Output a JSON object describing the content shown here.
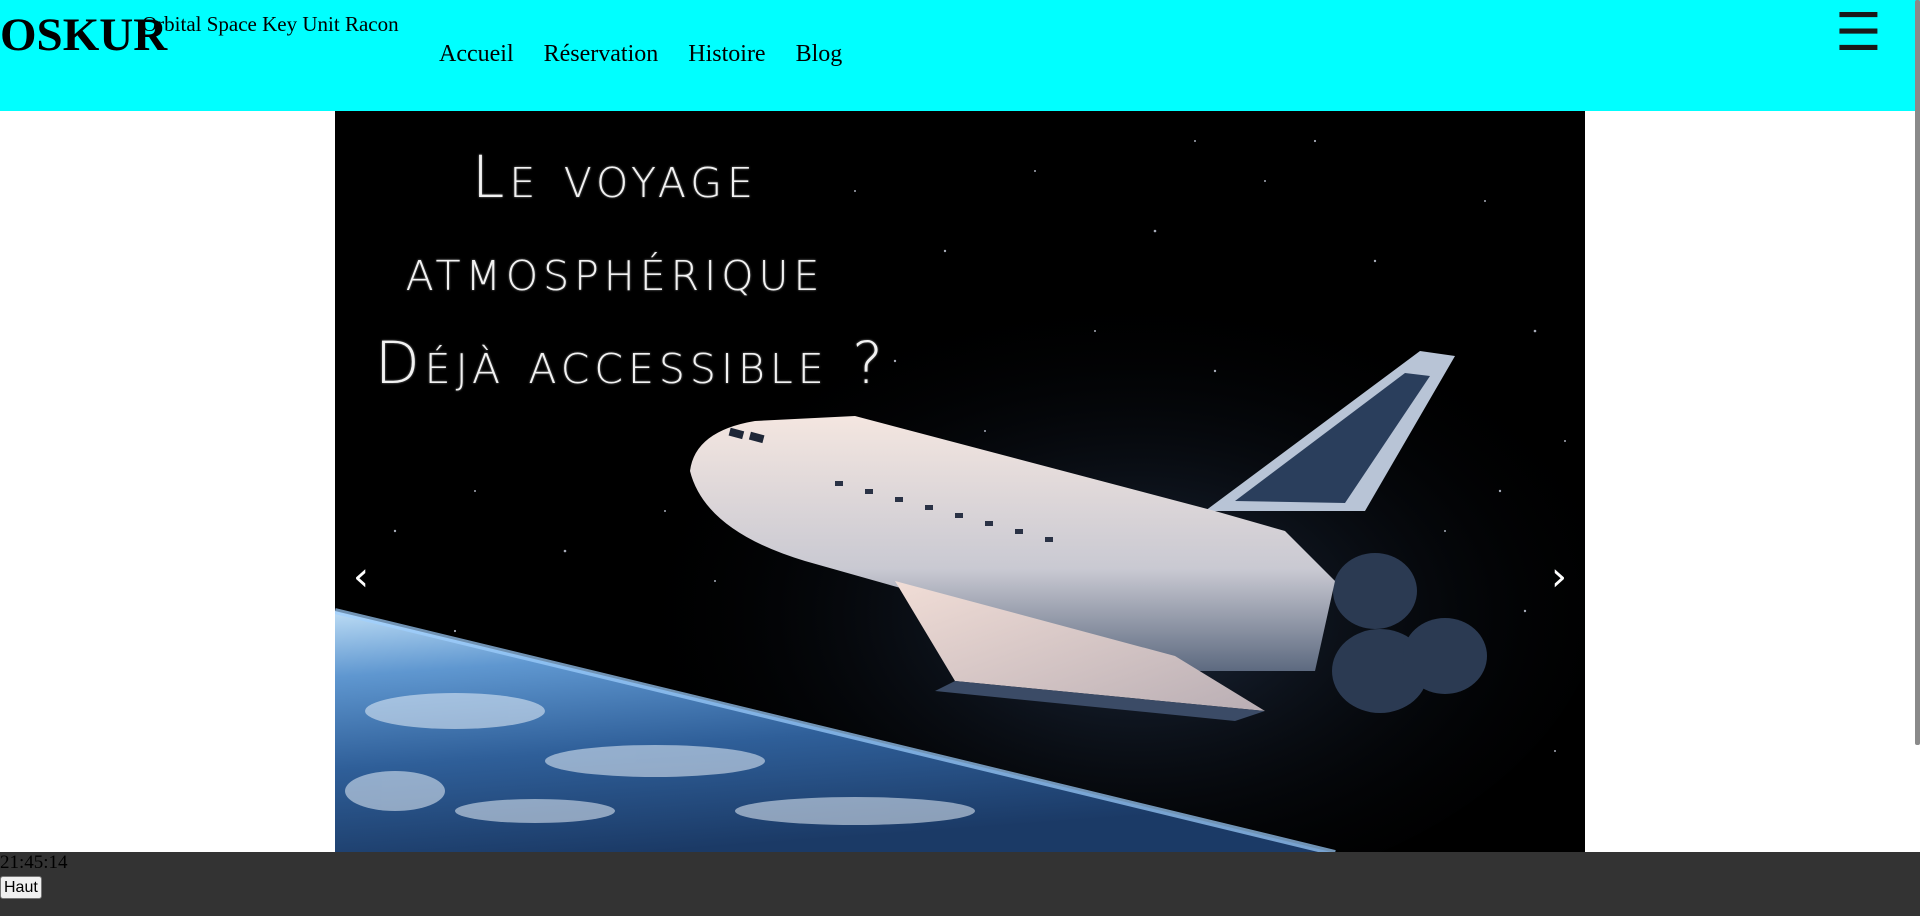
{
  "header": {
    "logo": "OSKUR",
    "tagline": "Orbital Space Key Unit Racon",
    "nav": [
      "Accueil",
      "Réservation",
      "Histoire",
      "Blog"
    ],
    "menu_icon": "hamburger-icon",
    "background_color": "#00ffff"
  },
  "slider": {
    "headline": [
      "Le voyage",
      "atmosphérique",
      "Déjà accessible ?"
    ],
    "prev_arrow": "‹",
    "next_arrow": "›",
    "image": "space-shuttle-over-earth"
  },
  "footer": {
    "clock": "21:45:14",
    "top_button": "Haut",
    "background_color": "#333333"
  }
}
